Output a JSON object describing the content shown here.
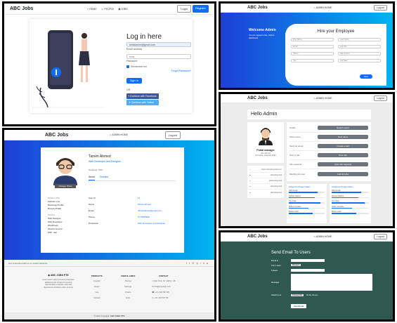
{
  "login": {
    "brand": "ABC Jobs",
    "nav": [
      "HOME",
      "PEOPLE",
      "JOBS"
    ],
    "login_btn": "Login",
    "register_btn": "Register",
    "title": "Log in here",
    "email_label": "Email address",
    "email_value": "amilaamiml@gmail.com",
    "password_value": "••••••",
    "password_label": "Password",
    "remember": "Remember me",
    "forgot": "Forgot Password?",
    "signin": "Sign In",
    "or": "OR",
    "facebook": "Continue with Facebook",
    "twitter": "Continue with Twitter"
  },
  "hire": {
    "brand": "ABC Jobs",
    "nav_admin": "ADMIN HOME",
    "logout": "Logout",
    "welcome": "Welcome Admin",
    "welcome_sub": "You are signed in the / Admin dashboard",
    "title": "Hire your Employee",
    "fields": [
      "First Name",
      "Last Name",
      "Email",
      "Job Title",
      "Phone",
      "Job location",
      "City",
      "Job Rate"
    ],
    "next": "Next"
  },
  "admin": {
    "brand": "ABC Jobs",
    "nav_admin": "ADMIN HOME",
    "logout": "Logout",
    "hello": "Hello Admin",
    "role": "Portal manager",
    "org": "Abc Job Ltd",
    "location": "Sri Lanka, Colombo 0000",
    "actions": [
      {
        "label": "Profile",
        "button": "Search users"
      },
      {
        "label": "Show users",
        "button": "View users"
      },
      {
        "label": "Send an email",
        "button": "Create email"
      },
      {
        "label": "Post a Job",
        "button": "Post Job"
      },
      {
        "label": "Job requests",
        "button": "View Job requests"
      },
      {
        "label": "Monthly job post",
        "button": "Call all Jobs"
      }
    ],
    "social": [
      {
        "name": "Website",
        "value": "https://abcjobsportal.com"
      },
      {
        "name": "Github",
        "value": "/abcjobsportal"
      },
      {
        "name": "Twitter",
        "value": "@abcjobsportal"
      },
      {
        "name": "Instagram",
        "value": "/abcjobsportal"
      },
      {
        "name": "Facebook",
        "value": "/abcjobsportal"
      }
    ],
    "status_title": "Assignment  Project Status",
    "bars": [
      {
        "label": "Web Design",
        "value": 0.8
      },
      {
        "label": "Website Markup",
        "value": 0.72
      },
      {
        "label": "One Page",
        "value": 0.88
      },
      {
        "label": "Mobile Template",
        "value": 0.55
      },
      {
        "label": "Backend API",
        "value": 0.66
      }
    ]
  },
  "profile": {
    "brand": "ABC Jobs",
    "nav_admin": "ADMIN HOME",
    "logout": "Logout",
    "name": "Tamim Ahmed",
    "role_title": "Web Developer and Designer",
    "rankings": "Rankings: 8/10",
    "tabs": [
      "About",
      "Timeline"
    ],
    "photo_btn": "Change Photo",
    "work_head": "WORK LINK",
    "work_links": [
      "Website Link",
      "Bootsnipp Profile",
      "Bootply Profile"
    ],
    "skills_head": "SKILLS",
    "skills": [
      "Web Designer",
      "Web Developer",
      "WordPress",
      "WooCommerce",
      "PHP, .Net"
    ],
    "fields": [
      {
        "k": "User Id",
        "v": "11"
      },
      {
        "k": "Name",
        "v": "Tamim Ahmed"
      },
      {
        "k": "Email",
        "v": "tamimahmed@gmail.com"
      },
      {
        "k": "Phone",
        "v": "0773695966"
      },
      {
        "k": "Profession",
        "v": "Web Developer and Designer"
      }
    ],
    "social_text": "Get connected with us on social networks:",
    "company": "ABC JOBS PTE",
    "company_desc": "Lorem ipsum dolor sit amet consectetur adipisicing elit. Deserunt tempora reprehenderit voluptate nulla velit dignissimos architecto dolor sit amet",
    "col_heads": [
      "PRODUCTS",
      "USEFUL LINKS",
      "CONTACT"
    ],
    "products": [
      "Angular",
      "React",
      "Vue",
      "Laravel"
    ],
    "links": [
      "Pricing",
      "Settings",
      "Orders",
      "Help"
    ],
    "contact": [
      "New York, NY 10012, US",
      "info@example.com",
      "+ 01 234 567 88",
      "+ 01 234 567 89"
    ],
    "copyright": "© 2021 Copyright:",
    "copyright_brand": "ABC JOBS PTE"
  },
  "email": {
    "brand": "ABC Jobs",
    "nav_admin": "ADMIN HOME",
    "logout": "Logout",
    "title": "Send Email To Users",
    "labels": [
      "Email to",
      "Print Users",
      "Subject",
      "Message",
      "Attachment"
    ],
    "users_btn": "All users",
    "choose_btn": "Choose File",
    "no_file": "No file chosen",
    "send": "Send Email"
  },
  "colors": {
    "primary": "#0d6efd",
    "gradient_blue": "#1e3fd6",
    "gradient_cyan": "#00b3f0",
    "email_bg": "#2f5851",
    "admin_bg": "#ececec",
    "footer_bg": "#f5f5f5"
  }
}
